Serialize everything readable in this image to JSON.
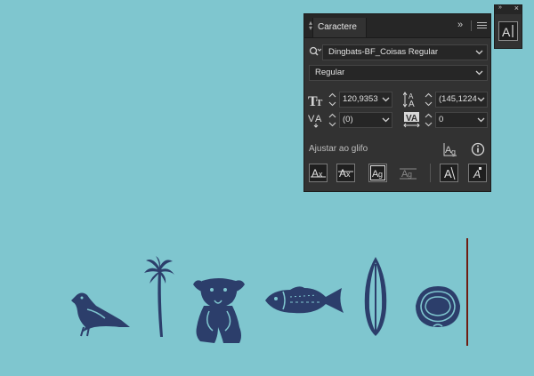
{
  "panel": {
    "tab_title": "Caractere",
    "font_family": "Dingbats-BF_Coisas Regular",
    "font_style": "Regular",
    "font_size": "120,9353",
    "leading": "(145,1224",
    "kerning": "(0)",
    "tracking": "0",
    "snap_to_glyph_label": "Ajustar ao glifo"
  },
  "colors": {
    "background": "#7fc6cf",
    "glyph_fill": "#2c3e6b",
    "panel_bg": "#323232",
    "caret": "#6e1d12"
  },
  "canvas": {
    "glyph_icons": [
      "bird-icon",
      "palm-tree-icon",
      "dog-icon",
      "fish-icon",
      "surfboard-icon",
      "clam-shell-icon"
    ]
  }
}
